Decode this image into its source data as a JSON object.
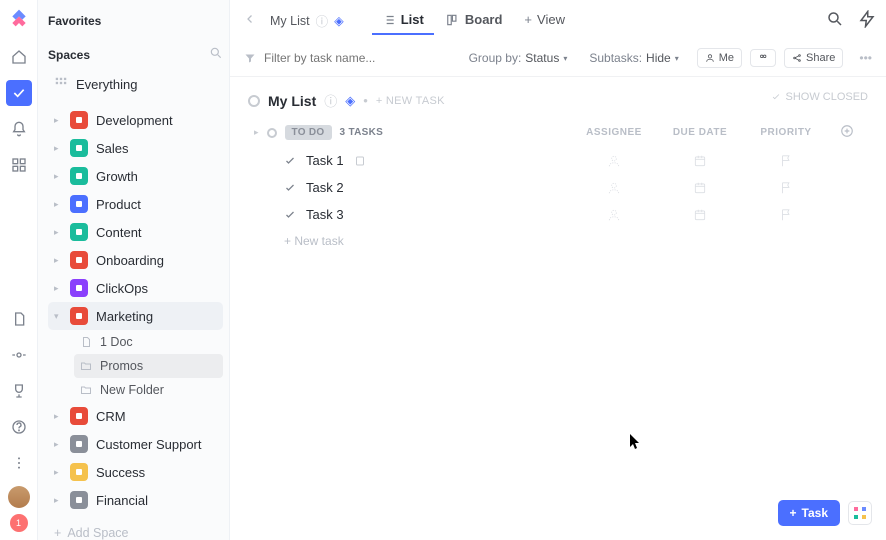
{
  "sidebar": {
    "favorites_label": "Favorites",
    "spaces_label": "Spaces",
    "everything_label": "Everything",
    "add_space_label": "Add Space",
    "spaces": [
      {
        "name": "Development",
        "color": "#e84b3a"
      },
      {
        "name": "Sales",
        "color": "#1abc9c"
      },
      {
        "name": "Growth",
        "color": "#1abc9c"
      },
      {
        "name": "Product",
        "color": "#4b6fff"
      },
      {
        "name": "Content",
        "color": "#1abc9c"
      },
      {
        "name": "Onboarding",
        "color": "#e84b3a"
      },
      {
        "name": "ClickOps",
        "color": "#8a3ffc"
      },
      {
        "name": "Marketing",
        "color": "#e84b3a"
      },
      {
        "name": "CRM",
        "color": "#e84b3a"
      },
      {
        "name": "Customer Support",
        "color": "#8a8f99"
      },
      {
        "name": "Success",
        "color": "#f5c24d"
      },
      {
        "name": "Financial",
        "color": "#8a8f99"
      }
    ],
    "marketing_children": [
      {
        "label": "1 Doc",
        "icon": "doc"
      },
      {
        "label": "Promos",
        "icon": "folder"
      },
      {
        "label": "New Folder",
        "icon": "folder"
      }
    ]
  },
  "breadcrumb": {
    "list_name": "My List"
  },
  "views": {
    "list": "List",
    "board": "Board",
    "add": "View"
  },
  "filterbar": {
    "placeholder": "Filter by task name...",
    "group_by_label": "Group by:",
    "group_by_value": "Status",
    "subtasks_label": "Subtasks:",
    "subtasks_value": "Hide",
    "me": "Me",
    "share": "Share"
  },
  "list": {
    "title": "My List",
    "new_task_inline": "+ NEW TASK",
    "show_closed": "SHOW CLOSED",
    "status_name": "TO DO",
    "task_count": "3 TASKS",
    "columns": {
      "assignee": "ASSIGNEE",
      "due": "DUE DATE",
      "priority": "PRIORITY"
    },
    "tasks": [
      {
        "name": "Task 1"
      },
      {
        "name": "Task 2"
      },
      {
        "name": "Task 3"
      }
    ],
    "new_task_row": "+ New task"
  },
  "fab": {
    "task": "Task"
  },
  "badge": "1"
}
